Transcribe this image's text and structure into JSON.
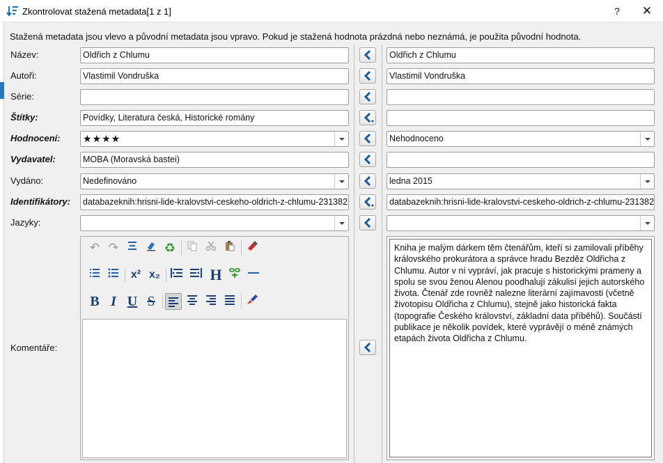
{
  "window": {
    "title": "Zkontrolovat stažená metadata[1 z 1]",
    "help": "?",
    "close": "✕"
  },
  "info_text": "Stažená metadata jsou vlevo a původní metadata jsou vpravo. Pokud je stažená hodnota prázdná nebo neznámá, je použita původní hodnota.",
  "labels": {
    "title": "Název:",
    "authors": "Autoři:",
    "series": "Série:",
    "tags": "Štítky:",
    "rating": "Hodnocení:",
    "publisher": "Vydavatel:",
    "published": "Vydáno:",
    "identifiers": "Identifikátory:",
    "languages": "Jazyky:",
    "comments": "Komentáře:"
  },
  "downloaded": {
    "title": "Oldřich z Chlumu",
    "authors": "Vlastimil Vondruška",
    "series": "",
    "tags": "Povídky, Literatura česká, Historické romány",
    "rating": "★★★★",
    "publisher": "MOBA (Moravská bastei)",
    "published": "Nedefinováno",
    "identifiers": "databazeknih:hrisni-lide-kralovstvi-ceskeho-oldrich-z-chlumu-231382",
    "languages": "",
    "comments": ""
  },
  "original": {
    "title": "Oldřich z Chlumu",
    "authors": "Vlastimil Vondruška",
    "series": "",
    "tags": "",
    "rating": "Nehodnoceno",
    "publisher": "",
    "published": "ledna 2015",
    "identifiers": "databazeknih:hrisni-lide-kralovstvi-ceskeho-oldrich-z-chlumu-231382",
    "languages": "",
    "comments": "Kniha je malým dárkem těm čtenářům, kteří si zamilovali příběhy královského prokurátora a správce hradu Bezděz Oldřicha z Chlumu. Autor v ní vypráví, jak pracuje s historickými prameny a spolu se svou ženou Alenou poodhalují zákulisí jejich autorského života. Čtenář zde rovněž nalezne literární zajímavosti (včetně životopisu Oldřicha z Chlumu), stejně jako historická fakta (topografie Českého království, základní data příběhů). Součástí publikace je několik povídek, které vyprávějí o méně známých etapách života Oldřicha z Chlumu."
  },
  "toolbar": {
    "row1": [
      "undo-icon",
      "redo-icon",
      "select-all-icon",
      "clear-formatting-icon",
      "recycle-icon",
      "copy-icon",
      "cut-icon",
      "paste-icon",
      "insert-image-icon"
    ],
    "row2": [
      "ordered-list-icon",
      "unordered-list-icon",
      "superscript-icon",
      "subscript-icon",
      "indent-icon",
      "outdent-icon",
      "heading-icon",
      "insert-link-icon",
      "horizontal-rule-icon"
    ],
    "row3": [
      "bold-icon",
      "italic-icon",
      "underline-icon",
      "strikethrough-icon",
      "align-left-icon",
      "align-center-icon",
      "align-right-icon",
      "justify-icon",
      "text-color-icon"
    ],
    "superscript_label": "x²",
    "subscript_label": "x₂",
    "heading_label": "H",
    "bold_label": "B",
    "italic_label": "I",
    "underline_label": "U",
    "strike_label": "S"
  },
  "colors": {
    "accent": "#1f6fb5",
    "copy_arrow": "#1d5a9a"
  }
}
